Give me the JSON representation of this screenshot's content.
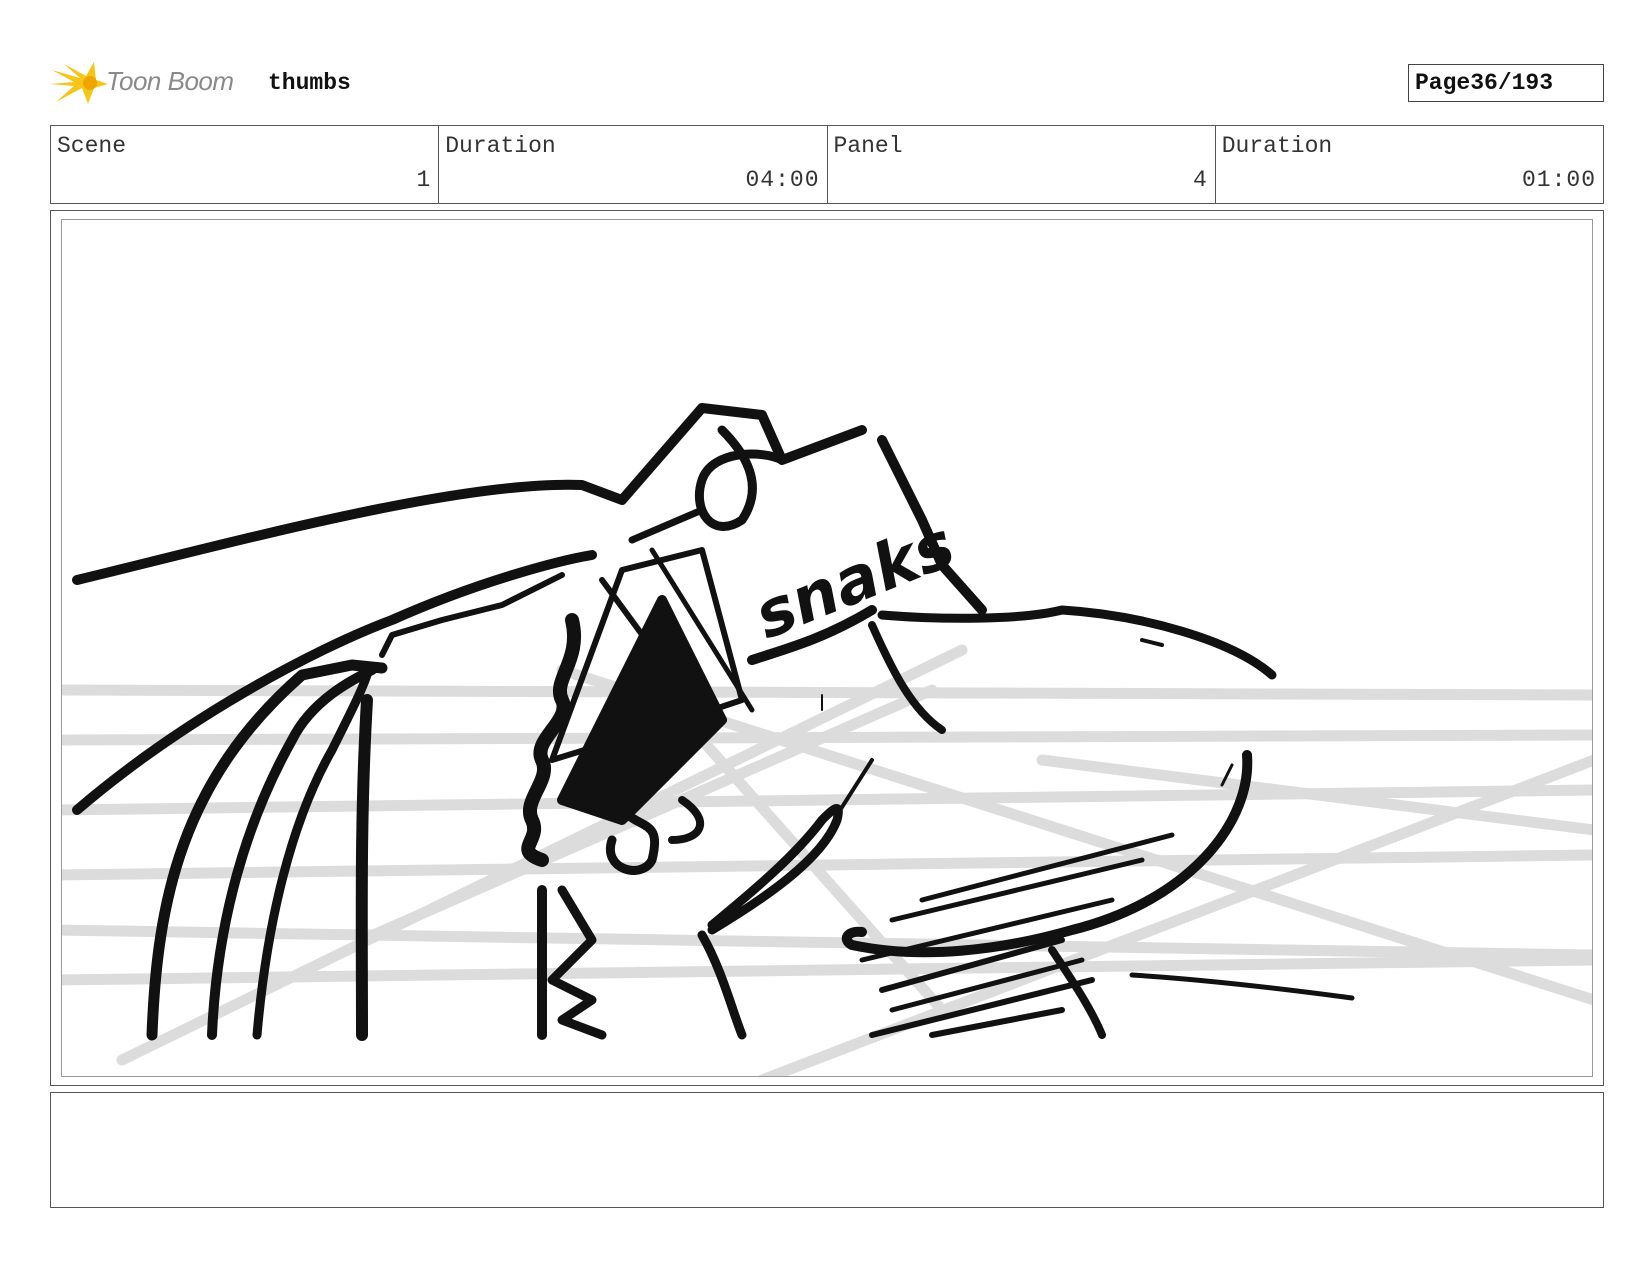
{
  "header": {
    "logo_text": "Toon Boom",
    "project_name": "thumbs",
    "page_label": "Page",
    "page_number": "36/193"
  },
  "info": {
    "scene_label": "Scene",
    "scene_value": "1",
    "scene_duration_label": "Duration",
    "scene_duration_value": "04:00",
    "panel_label": "Panel",
    "panel_value": "4",
    "panel_duration_label": "Duration",
    "panel_duration_value": "01:00"
  },
  "panel": {
    "sketch_text": "snaks"
  },
  "caption": {
    "text": ""
  },
  "colors": {
    "logo_yellow": "#f5c518",
    "logo_orange": "#f0a500",
    "sketch_ink": "#111111",
    "guide_gray": "#dcdcdc"
  },
  "icons": {
    "logo": "toon-boom-star-icon"
  }
}
